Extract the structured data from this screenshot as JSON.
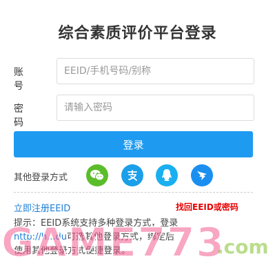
{
  "title": "综合素质评价平台登录",
  "account": {
    "label": "账 号",
    "placeholder": "EEID/手机号码/别称"
  },
  "password": {
    "label": "密 码",
    "placeholder": "请输入密码"
  },
  "login_button": "登录",
  "other_login": {
    "label": "其他登录方式",
    "providers": [
      {
        "name": "wechat",
        "icon": "wechat-icon",
        "color": "#5bbd2b"
      },
      {
        "name": "alipay",
        "icon": "alipay-icon",
        "color": "#1a9fe8"
      },
      {
        "name": "qq",
        "icon": "qq-icon",
        "color": "#1aaff0"
      },
      {
        "name": "dingtalk",
        "icon": "dingtalk-icon",
        "color": "#1a8ff0"
      }
    ]
  },
  "register_link": "立即注册EEID",
  "recover_link": "找回EEID或密码",
  "tip": {
    "line1": "提示：EEID系统支持多种登录方式，登录",
    "line2_link": "http://h...du",
    "line2_rest": "可选其他登录方式，绑定后",
    "line3": "使用其他登录方式便捷登录。"
  },
  "watermark": {
    "text": "GAME773",
    "suffix": ".com",
    "colors": {
      "pink": "#f25d8e",
      "yellow": "#f5c400",
      "green": "#8cc63f"
    }
  },
  "colors": {
    "primary": "#1e9bf0",
    "link": "#1e7ed6",
    "danger": "#e60000"
  }
}
